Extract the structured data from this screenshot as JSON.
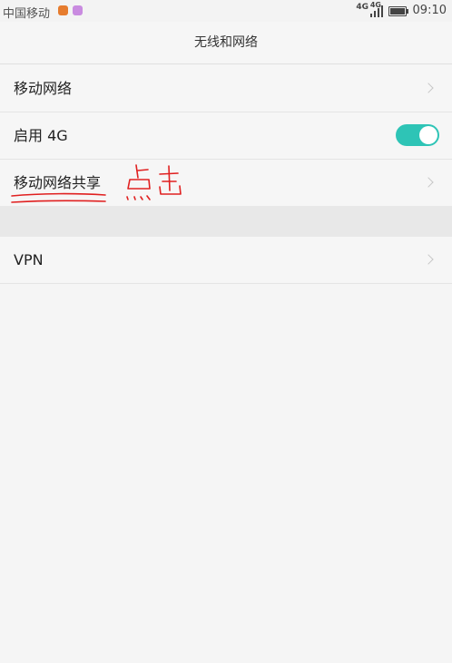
{
  "status_bar": {
    "carrier": "中国移动",
    "network_1": "4G",
    "network_2": "4G",
    "time": "09:10"
  },
  "header": {
    "title": "无线和网络"
  },
  "rows": [
    {
      "label": "移动网络"
    },
    {
      "label": "启用 4G",
      "toggle_on": true
    },
    {
      "label": "移动网络共享"
    },
    {
      "label": "VPN"
    }
  ],
  "colors": {
    "toggle_on": "#2ec4b6",
    "annotation": "#e02020"
  },
  "annotation": {
    "handwritten": "点击"
  }
}
